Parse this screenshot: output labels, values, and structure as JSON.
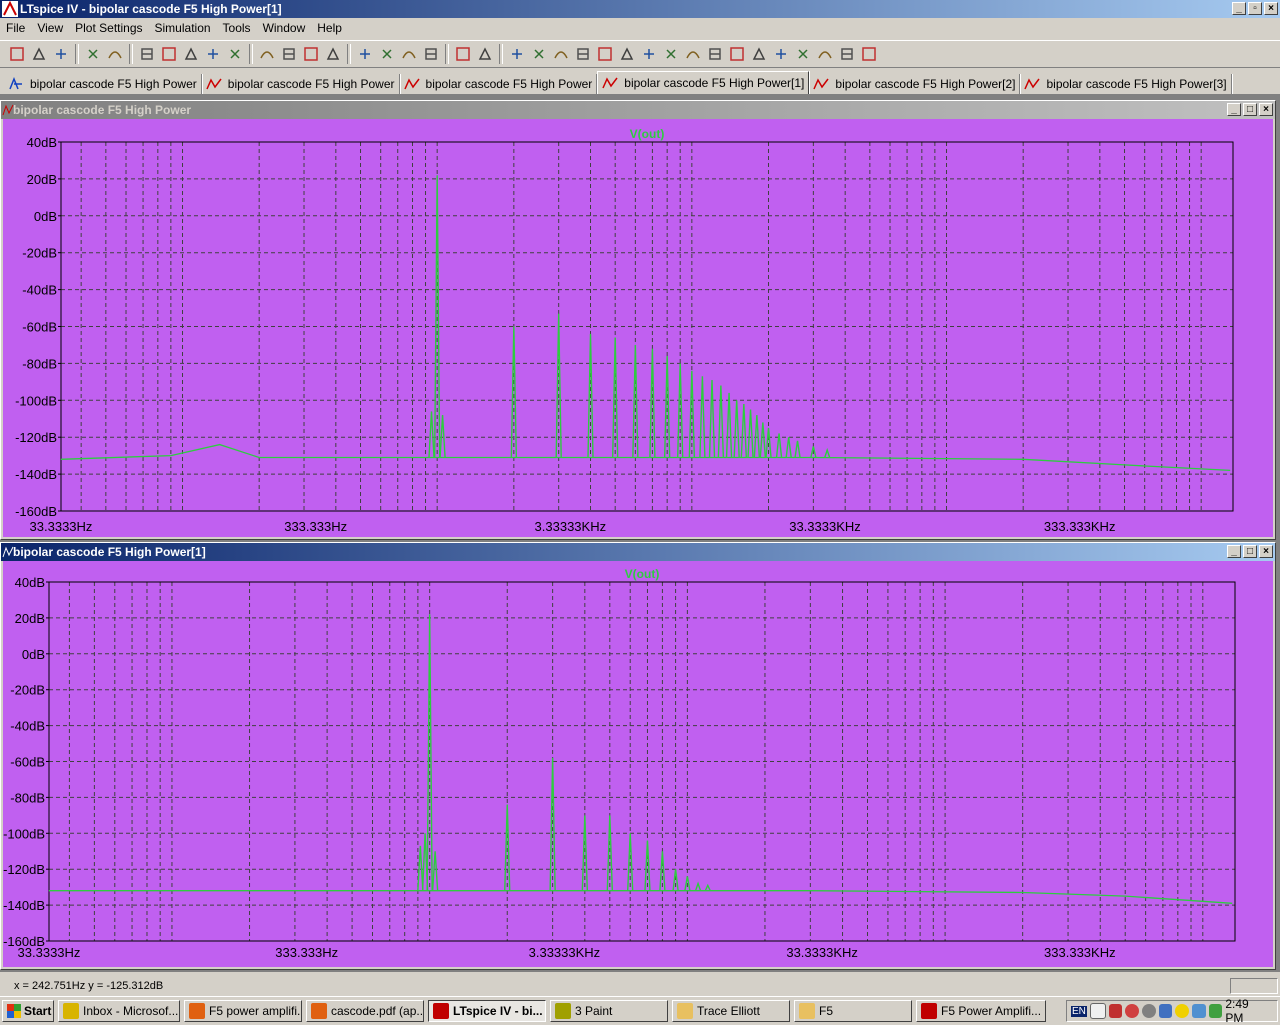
{
  "window": {
    "title": "LTspice IV - bipolar cascode F5 High Power[1]"
  },
  "menu": [
    "File",
    "View",
    "Plot Settings",
    "Simulation",
    "Tools",
    "Window",
    "Help"
  ],
  "toolbar_icons": [
    "new-schematic-icon",
    "open-icon",
    "save-icon",
    "control-panel-icon",
    "run-icon",
    "halt-icon",
    "zoom-in-icon",
    "zoom-box-icon",
    "zoom-out-icon",
    "zoom-fit-icon",
    "autorange-icon",
    "grid-icon",
    "tile-horizontal-icon",
    "cascade-icon",
    "tile-vertical-icon",
    "cut-icon",
    "copy-icon",
    "paste-icon",
    "find-icon",
    "print-preview-icon",
    "print-icon",
    "wire-icon",
    "ground-icon",
    "label-icon",
    "resistor-icon",
    "capacitor-icon",
    "inductor-icon",
    "diode-icon",
    "component-icon",
    "move-icon",
    "drag-icon",
    "undo-icon",
    "redo-icon",
    "rotate-icon",
    "mirror-icon",
    "text-icon",
    "spice-directive-icon"
  ],
  "tabs": [
    {
      "label": "bipolar cascode F5 High Power",
      "icon": "schematic-icon"
    },
    {
      "label": "bipolar cascode F5 High Power",
      "icon": "waveform-icon"
    },
    {
      "label": "bipolar cascode F5 High Power",
      "icon": "waveform-icon"
    },
    {
      "label": "bipolar cascode F5 High Power[1]",
      "icon": "waveform-icon",
      "active": true
    },
    {
      "label": "bipolar cascode F5 High Power[2]",
      "icon": "waveform-icon"
    },
    {
      "label": "bipolar cascode F5 High Power[3]",
      "icon": "waveform-icon"
    }
  ],
  "panes": [
    {
      "title": "bipolar cascode F5 High Power",
      "active": false
    },
    {
      "title": "bipolar cascode F5 High Power[1]",
      "active": true
    }
  ],
  "chart_data": [
    {
      "type": "line",
      "title": "V(out)",
      "x_scale": "log",
      "x_range_hz": [
        33.3333,
        1333333
      ],
      "y_range_db": [
        -160,
        40
      ],
      "y_ticks": [
        "40dB",
        "20dB",
        "0dB",
        "-20dB",
        "-40dB",
        "-60dB",
        "-80dB",
        "-100dB",
        "-120dB",
        "-140dB",
        "-160dB"
      ],
      "x_ticks": [
        "33.3333Hz",
        "333.333Hz",
        "3.33333KHz",
        "33.3333KHz",
        "333.333KHz"
      ],
      "grid": true,
      "color": "#2ecc40",
      "noise_floor": [
        [
          33.3,
          -132
        ],
        [
          90,
          -130
        ],
        [
          140,
          -124
        ],
        [
          200,
          -131
        ],
        [
          700,
          -131
        ],
        [
          4000,
          -131
        ],
        [
          30000,
          -131
        ],
        [
          200000,
          -132
        ],
        [
          500000,
          -135
        ],
        [
          1300000,
          -138
        ]
      ],
      "spikes": [
        {
          "f": 950,
          "db": -106
        },
        {
          "f": 1000,
          "db": 22
        },
        {
          "f": 1050,
          "db": -108
        },
        {
          "f": 2000,
          "db": -60
        },
        {
          "f": 3000,
          "db": -53
        },
        {
          "f": 4000,
          "db": -64
        },
        {
          "f": 5000,
          "db": -66
        },
        {
          "f": 6000,
          "db": -70
        },
        {
          "f": 7000,
          "db": -72
        },
        {
          "f": 8000,
          "db": -76
        },
        {
          "f": 9000,
          "db": -80
        },
        {
          "f": 10000,
          "db": -84
        },
        {
          "f": 11000,
          "db": -87
        },
        {
          "f": 12000,
          "db": -89
        },
        {
          "f": 13000,
          "db": -92
        },
        {
          "f": 14000,
          "db": -96
        },
        {
          "f": 15000,
          "db": -100
        },
        {
          "f": 16000,
          "db": -102
        },
        {
          "f": 17000,
          "db": -105
        },
        {
          "f": 18000,
          "db": -108
        },
        {
          "f": 19000,
          "db": -112
        },
        {
          "f": 20000,
          "db": -115
        },
        {
          "f": 22000,
          "db": -118
        },
        {
          "f": 24000,
          "db": -120
        },
        {
          "f": 26000,
          "db": -122
        },
        {
          "f": 30000,
          "db": -125
        },
        {
          "f": 34000,
          "db": -127
        }
      ]
    },
    {
      "type": "line",
      "title": "V(out)",
      "x_scale": "log",
      "x_range_hz": [
        33.3333,
        1333333
      ],
      "y_range_db": [
        -160,
        40
      ],
      "y_ticks": [
        "40dB",
        "20dB",
        "0dB",
        "-20dB",
        "-40dB",
        "-60dB",
        "-80dB",
        "-100dB",
        "-120dB",
        "-140dB",
        "-160dB"
      ],
      "x_ticks": [
        "33.3333Hz",
        "333.333Hz",
        "3.33333KHz",
        "33.3333KHz",
        "333.333KHz"
      ],
      "grid": true,
      "color": "#2ecc40",
      "noise_floor": [
        [
          33.3,
          -132
        ],
        [
          700,
          -132
        ],
        [
          4000,
          -132
        ],
        [
          30000,
          -132
        ],
        [
          200000,
          -133
        ],
        [
          500000,
          -135
        ],
        [
          1300000,
          -139
        ]
      ],
      "spikes": [
        {
          "f": 920,
          "db": -107
        },
        {
          "f": 960,
          "db": -100
        },
        {
          "f": 1000,
          "db": 22
        },
        {
          "f": 1050,
          "db": -110
        },
        {
          "f": 2000,
          "db": -84
        },
        {
          "f": 3000,
          "db": -58
        },
        {
          "f": 4000,
          "db": -90
        },
        {
          "f": 5000,
          "db": -90
        },
        {
          "f": 6000,
          "db": -100
        },
        {
          "f": 7000,
          "db": -104
        },
        {
          "f": 8000,
          "db": -110
        },
        {
          "f": 9000,
          "db": -120
        },
        {
          "f": 10000,
          "db": -124
        },
        {
          "f": 11000,
          "db": -128
        },
        {
          "f": 12000,
          "db": -129
        }
      ]
    }
  ],
  "status": {
    "cursor": "x = 242.751Hz    y = -125.312dB"
  },
  "taskbar": {
    "start": "Start",
    "tasks": [
      {
        "label": "Inbox - Microsof...",
        "color": "#d8b400"
      },
      {
        "label": "F5 power amplifi...",
        "color": "#e06010"
      },
      {
        "label": "cascode.pdf (ap...",
        "color": "#e06010"
      },
      {
        "label": "LTspice IV - bi...",
        "color": "#c00000",
        "active": true
      },
      {
        "label": "3 Paint",
        "color": "#a0a000"
      },
      {
        "label": "Trace Elliott",
        "color": "#e8c060"
      },
      {
        "label": "F5",
        "color": "#e8c060"
      },
      {
        "label": "F5 Power Amplifi...",
        "color": "#c00000"
      }
    ],
    "clock": "2:49 PM",
    "tray_lang": "EN"
  }
}
